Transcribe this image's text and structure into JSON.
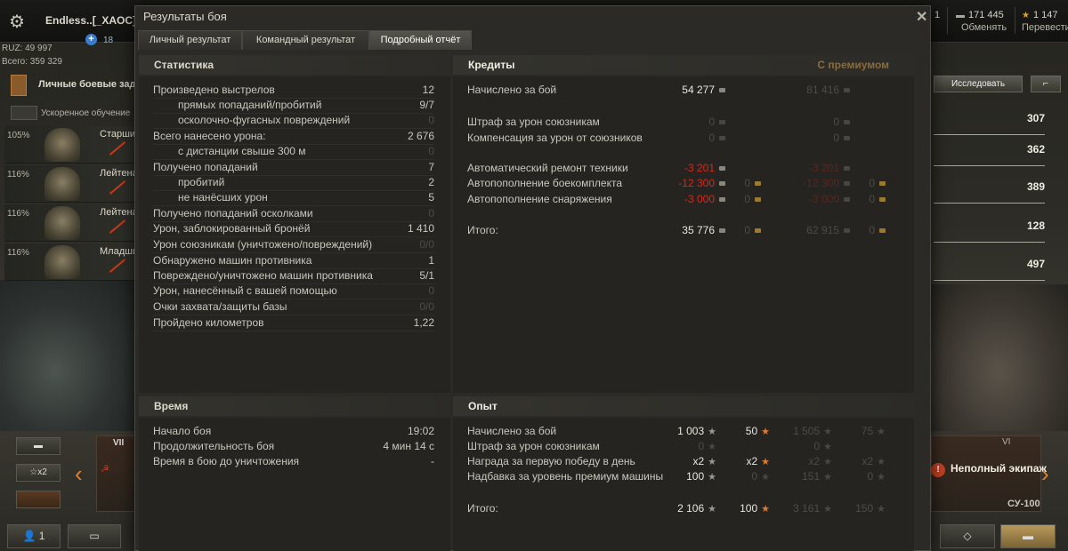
{
  "top": {
    "player_name": "Endless..[_XAOC]",
    "level": "18",
    "ruz": "RUZ: 49 997",
    "total": "Всего: 359 329",
    "currency_one": "1",
    "credits_value": "171 445",
    "credits_label": "Обменять",
    "gold_value": "1 147",
    "gold_label": "Перевести"
  },
  "left": {
    "tasks_label": "Личные боевые задачи",
    "accel_label": "Ускоренное обучение",
    "crew": [
      {
        "pct": "105%",
        "rank": "Старшина"
      },
      {
        "pct": "116%",
        "rank": "Лейтенант"
      },
      {
        "pct": "116%",
        "rank": "Лейтенант"
      },
      {
        "pct": "116%",
        "rank": "Младший"
      }
    ],
    "x2_label": "☆x2",
    "tank_tier": "VII",
    "platoon_count": "1"
  },
  "right": {
    "research_label": "Исследовать",
    "stats": [
      "307",
      "362",
      "389",
      "128",
      "497"
    ],
    "incomplete_crew": "Неполный экипаж",
    "tank_tier": "VI",
    "tank_name": "СУ-100"
  },
  "modal": {
    "title": "Результаты боя",
    "tabs": [
      "Личный результат",
      "Командный результат",
      "Подробный отчёт"
    ],
    "stats_header": "Статистика",
    "stats_rows": [
      {
        "label": "Произведено выстрелов",
        "value": "12",
        "indent": false,
        "dim": false
      },
      {
        "label": "прямых попаданий/пробитий",
        "value": "9/7",
        "indent": true,
        "dim": false
      },
      {
        "label": "осколочно-фугасных повреждений",
        "value": "0",
        "indent": true,
        "dim": true
      },
      {
        "label": "Всего нанесено урона:",
        "value": "2 676",
        "indent": false,
        "dim": false
      },
      {
        "label": "с дистанции свыше 300 м",
        "value": "0",
        "indent": true,
        "dim": true
      },
      {
        "label": "Получено попаданий",
        "value": "7",
        "indent": false,
        "dim": false
      },
      {
        "label": "пробитий",
        "value": "2",
        "indent": true,
        "dim": false
      },
      {
        "label": "не нанёсших урон",
        "value": "5",
        "indent": true,
        "dim": false
      },
      {
        "label": "Получено попаданий осколками",
        "value": "0",
        "indent": false,
        "dim": true
      },
      {
        "label": "Урон, заблокированный бронёй",
        "value": "1 410",
        "indent": false,
        "dim": false
      },
      {
        "label": "Урон союзникам (уничтожено/повреждений)",
        "value": "0/0",
        "indent": false,
        "dim": true
      },
      {
        "label": "Обнаружено машин противника",
        "value": "1",
        "indent": false,
        "dim": false
      },
      {
        "label": "Повреждено/уничтожено машин противника",
        "value": "5/1",
        "indent": false,
        "dim": false
      },
      {
        "label": "Урон, нанесённый с вашей помощью",
        "value": "0",
        "indent": false,
        "dim": true
      },
      {
        "label": "Очки захвата/защиты базы",
        "value": "0/0",
        "indent": false,
        "dim": true
      },
      {
        "label": "Пройдено километров",
        "value": "1,22",
        "indent": false,
        "dim": false
      }
    ],
    "credits_header": "Кредиты",
    "premium_label": "С премиумом",
    "credits_rows": [
      {
        "label": "Начислено за бой",
        "c1": "54 277",
        "g1": "",
        "c2": "81 416",
        "g2": "",
        "red": false,
        "dim1": false
      },
      {
        "label": "Штраф за урон союзникам",
        "c1": "0",
        "g1": "",
        "c2": "0",
        "g2": "",
        "red": false,
        "dim1": true
      },
      {
        "label": "Компенсация за урон от союзников",
        "c1": "0",
        "g1": "",
        "c2": "0",
        "g2": "",
        "red": false,
        "dim1": true
      },
      {
        "label": "Автоматический ремонт техники",
        "c1": "-3 201",
        "g1": "",
        "c2": "-3 201",
        "g2": "",
        "red": true,
        "dim1": false
      },
      {
        "label": "Автопополнение боекомплекта",
        "c1": "-12 300",
        "g1": "0",
        "c2": "-12 300",
        "g2": "0",
        "red": true,
        "dim1": false
      },
      {
        "label": "Автопополнение снаряжения",
        "c1": "-3 000",
        "g1": "0",
        "c2": "-3 000",
        "g2": "0",
        "red": true,
        "dim1": false
      },
      {
        "label": "Итого:",
        "c1": "35 776",
        "g1": "0",
        "c2": "62 915",
        "g2": "0",
        "red": false,
        "dim1": false
      }
    ],
    "time_header": "Время",
    "time_rows": [
      {
        "label": "Начало боя",
        "value": "19:02"
      },
      {
        "label": "Продолжительность боя",
        "value": "4 мин 14 с"
      },
      {
        "label": "Время в бою до уничтожения",
        "value": "-"
      }
    ],
    "exp_header": "Опыт",
    "exp_rows": [
      {
        "label": "Начислено за бой",
        "x1": "1 003",
        "f1": "50",
        "x2": "1 505",
        "f2": "75",
        "dim1": false
      },
      {
        "label": "Штраф за урон союзникам",
        "x1": "0",
        "f1": "",
        "x2": "0",
        "f2": "",
        "dim1": true
      },
      {
        "label": "Награда за первую победу в день",
        "x1": "x2",
        "f1": "x2",
        "x2": "x2",
        "f2": "x2",
        "dim1": false
      },
      {
        "label": "Надбавка за уровень премиум машины",
        "x1": "100",
        "f1": "0",
        "x2": "151",
        "f2": "0",
        "dim1": false
      },
      {
        "label": "Итого:",
        "x1": "2 106",
        "f1": "100",
        "x2": "3 161",
        "f2": "150",
        "dim1": false
      }
    ]
  },
  "colors": {
    "accent_orange": "#e0822a",
    "negative_red": "#d8281c",
    "premium_gold": "#8a6c3c"
  }
}
